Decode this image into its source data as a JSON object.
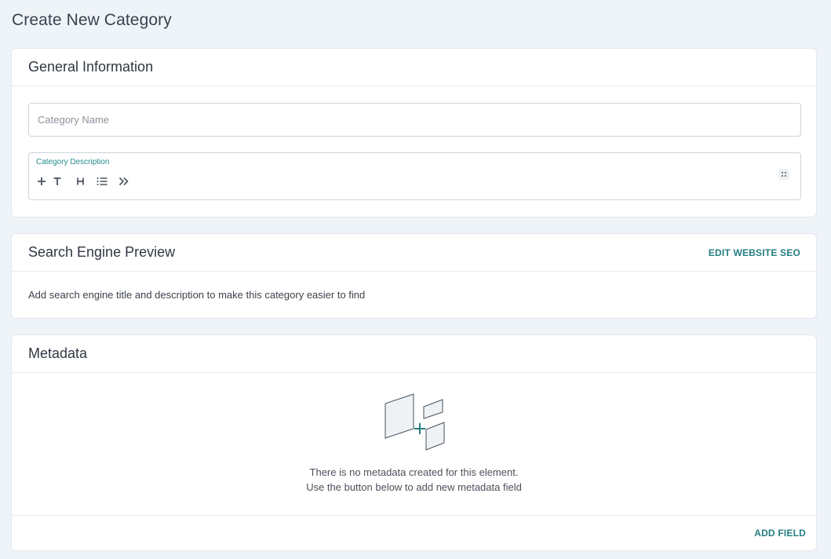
{
  "page": {
    "title": "Create New Category"
  },
  "general": {
    "title": "General Information",
    "name_placeholder": "Category Name",
    "name_value": "",
    "description_label": "Category Description",
    "toolbar_icons": [
      "plus-icon",
      "text-icon",
      "heading-icon",
      "list-icon",
      "quote-icon"
    ]
  },
  "seo": {
    "title": "Search Engine Preview",
    "edit_label": "EDIT WEBSITE SEO",
    "description": "Add search engine title and description to make this category easier to find"
  },
  "metadata": {
    "title": "Metadata",
    "empty_line1": "There is no metadata created for this element.",
    "empty_line2": "Use the button below to add new metadata field",
    "add_label": "ADD FIELD"
  },
  "colors": {
    "accent": "#247e82",
    "background": "#eff4f8",
    "card": "#ffffff",
    "border": "#e3e8ee"
  }
}
